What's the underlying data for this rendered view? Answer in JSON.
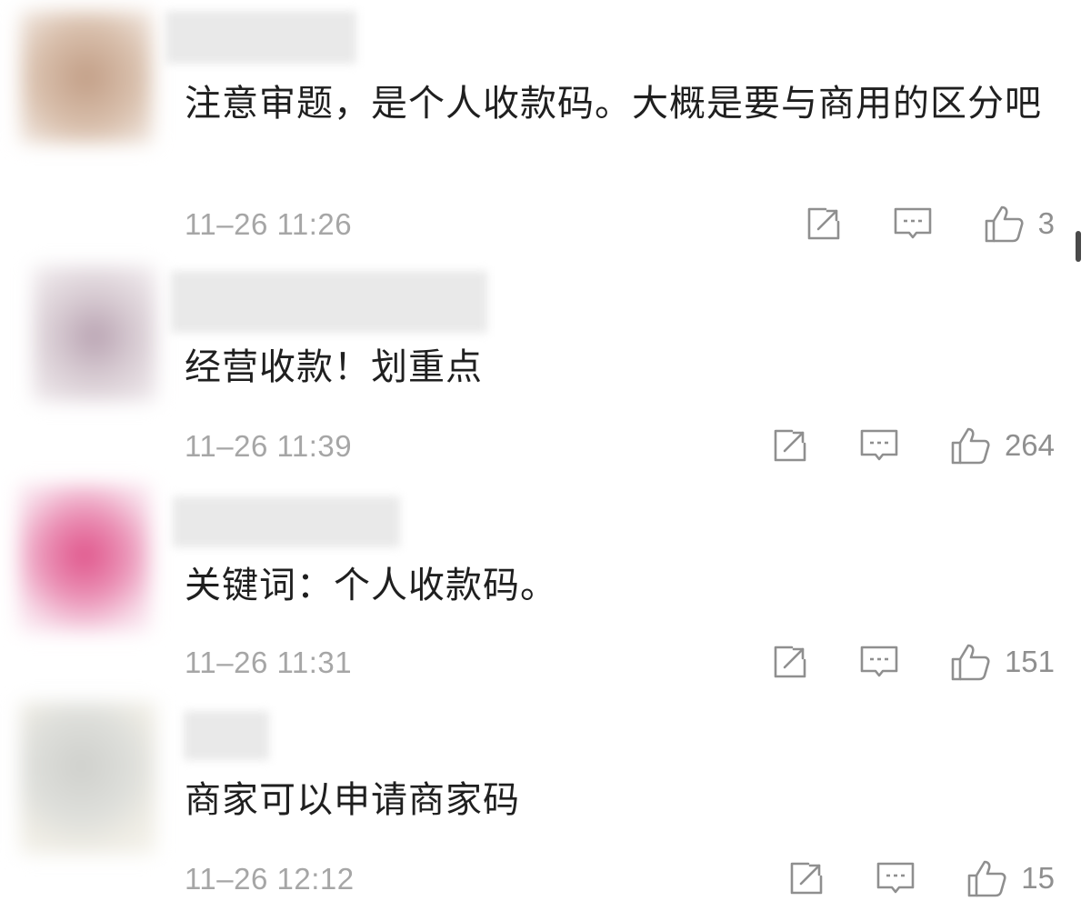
{
  "comments": [
    {
      "text": "注意审题，是个人收款码。大概是要与商用的区分吧",
      "time": "11–26 11:26",
      "likes": "3",
      "avatar_color": "#c9a68e"
    },
    {
      "text": "经营收款！划重点",
      "time": "11–26 11:39",
      "likes": "264",
      "avatar_color": "#bfb0bb"
    },
    {
      "text": "关键词：个人收款码。",
      "time": "11–26 11:31",
      "likes": "151",
      "avatar_color": "#e45c8f"
    },
    {
      "text": "商家可以申请商家码",
      "time": "11–26 12:12",
      "likes": "15",
      "avatar_color": "#d6d6d0"
    }
  ],
  "icons": {
    "share": "share-icon",
    "reply": "comment-icon",
    "like": "thumbs-up-icon"
  },
  "colors": {
    "text": "#1f1f1f",
    "meta": "#a6a6a6",
    "icon": "#8f8f8f"
  }
}
